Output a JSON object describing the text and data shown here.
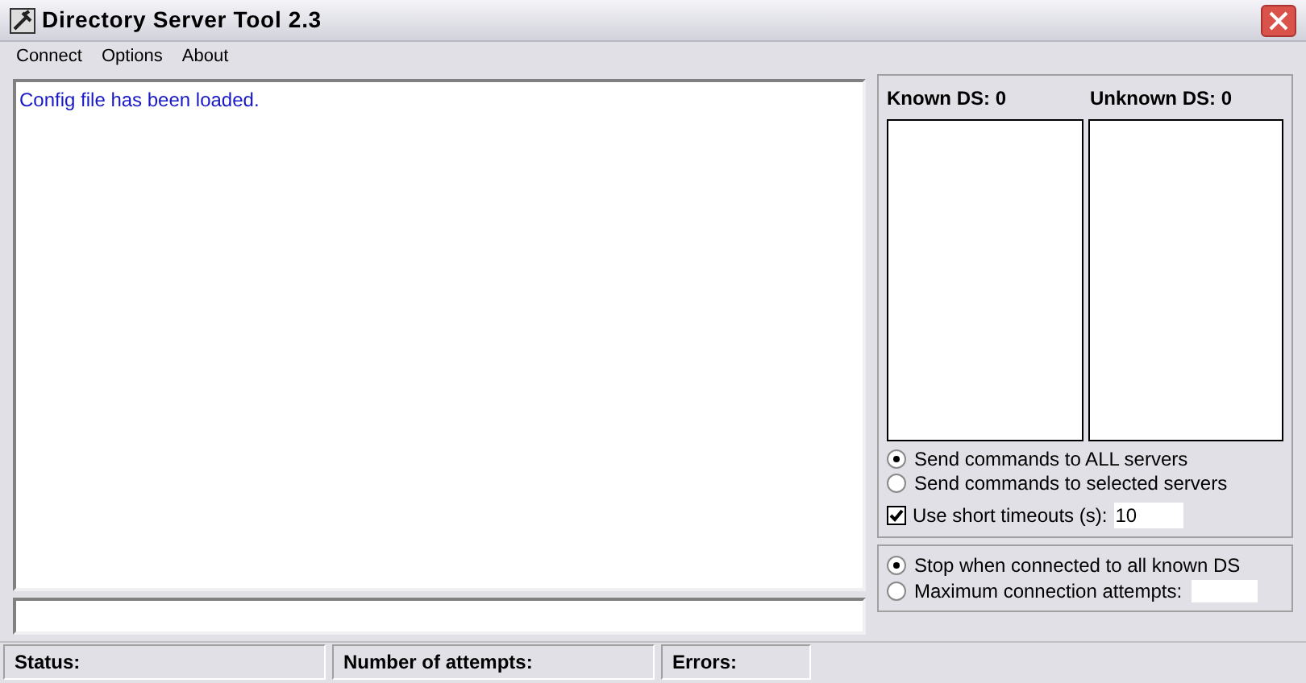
{
  "window": {
    "title": "Directory Server Tool 2.3"
  },
  "menu": [
    "Connect",
    "Options",
    "About"
  ],
  "log": {
    "lines": [
      "Config file has been loaded."
    ]
  },
  "servers": {
    "known_label": "Known DS: 0",
    "unknown_label": "Unknown DS: 0"
  },
  "send_options": [
    {
      "label": "Send commands to ALL servers",
      "selected": true
    },
    {
      "label": "Send commands to selected servers",
      "selected": false
    }
  ],
  "short_timeouts": {
    "label": "Use short timeouts (s):",
    "checked": true,
    "value": "10"
  },
  "connect_options": [
    {
      "label": "Stop when connected to all known DS",
      "selected": true,
      "kind": "plain"
    },
    {
      "label": "Maximum connection attempts:",
      "selected": false,
      "kind": "field"
    }
  ],
  "status_bar": [
    "Status:",
    "Number of attempts:",
    "Errors:"
  ]
}
